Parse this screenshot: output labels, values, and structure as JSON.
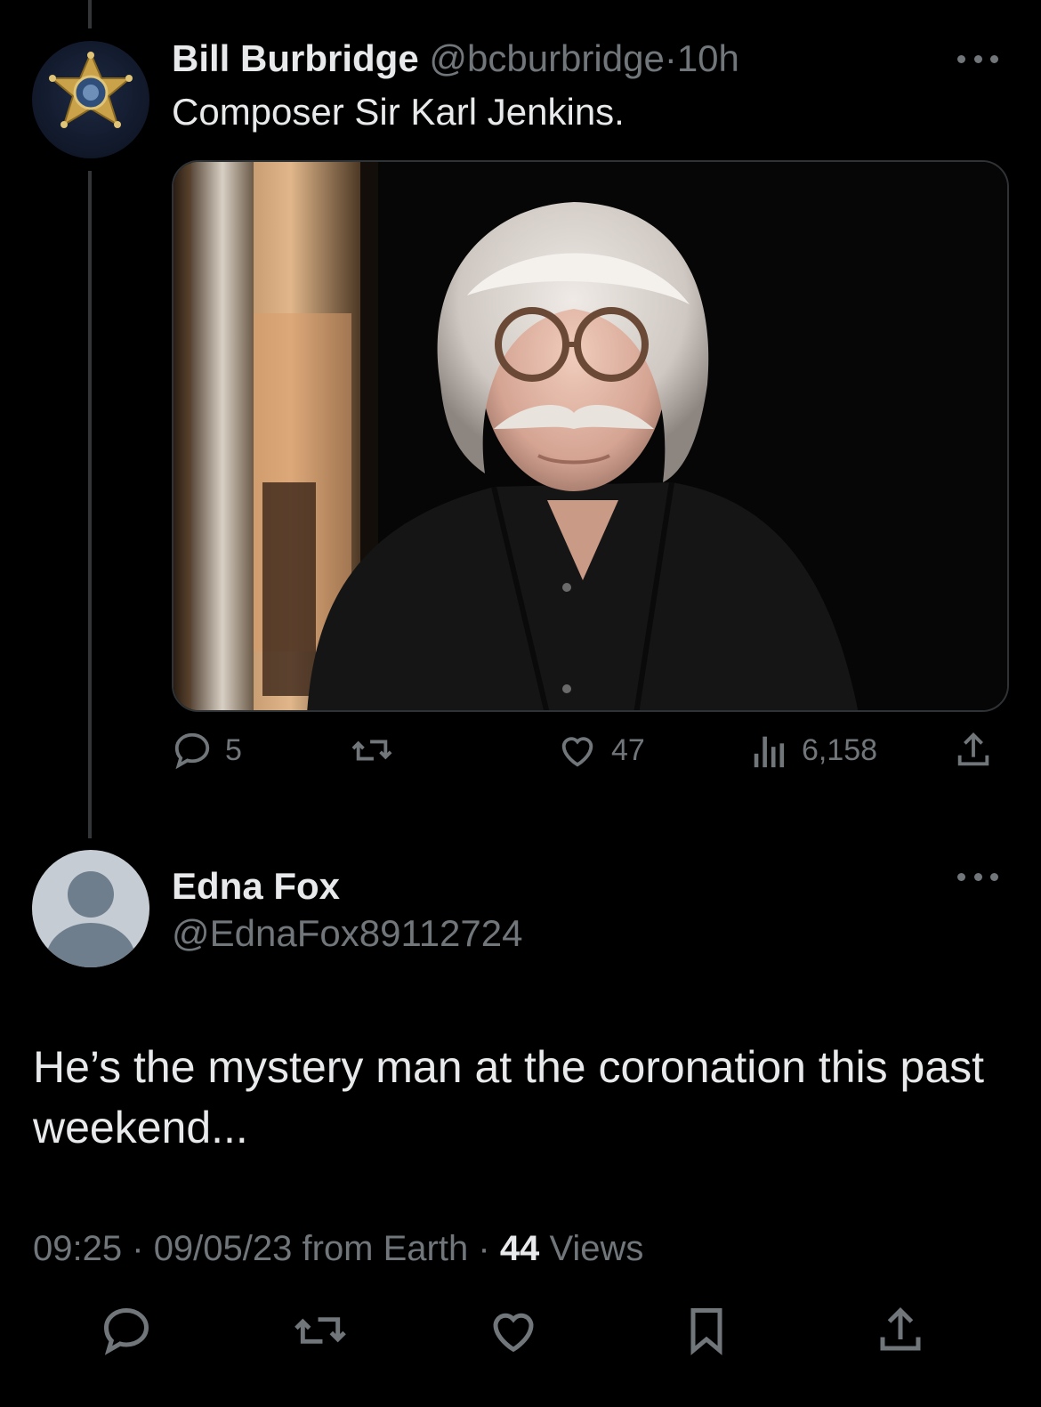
{
  "tweet": {
    "author_name": "Bill Burbridge",
    "author_handle": "@bcburbridge",
    "separator": "·",
    "time_ago": "10h",
    "text": "Composer Sir Karl Jenkins.",
    "avatar_icon": "sheriff-star-badge-icon",
    "stats": {
      "replies": "5",
      "likes": "47",
      "views": "6,158"
    }
  },
  "reply": {
    "author_name": "Edna Fox",
    "author_handle": "@EdnaFox89112724",
    "text": "He’s the mystery man at the coronation this past weekend...",
    "time": "09:25",
    "sep1": "·",
    "date": "09/05/23 from Earth",
    "sep2": "·",
    "views_count": "44",
    "views_label": "Views"
  },
  "colors": {
    "background": "#000000",
    "primary_text": "#e7e9ea",
    "secondary_text": "#71767b",
    "divider": "#333639"
  }
}
